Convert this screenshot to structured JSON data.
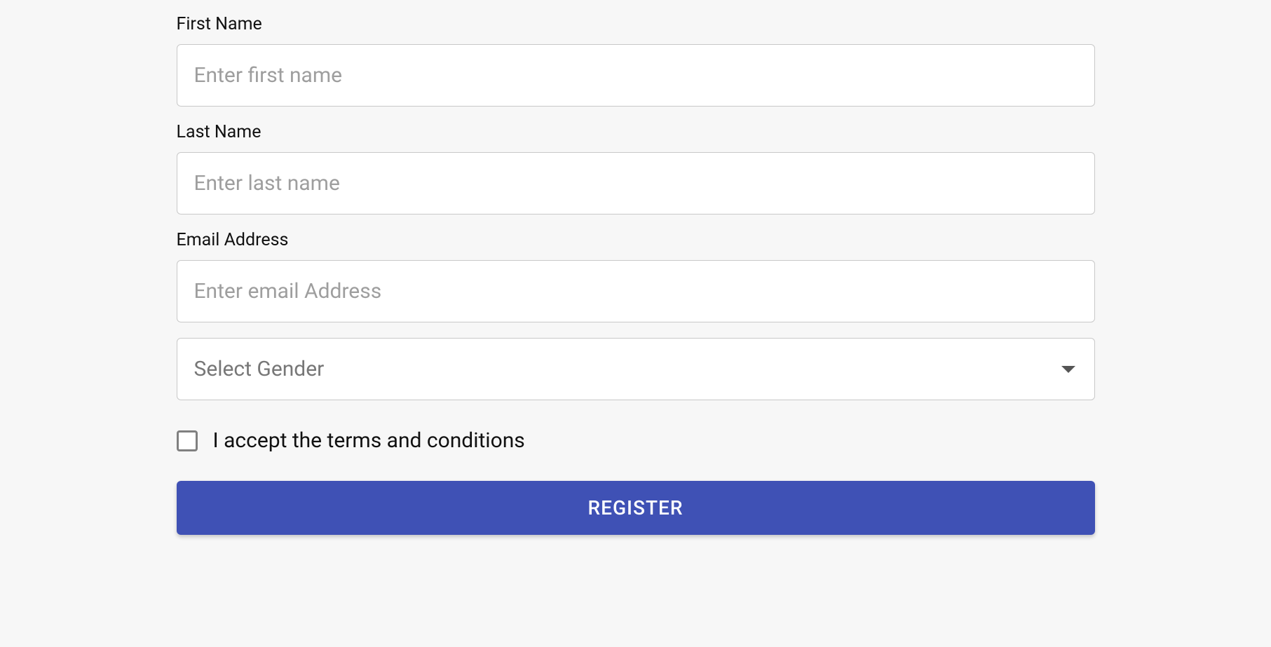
{
  "form": {
    "first_name": {
      "label": "First Name",
      "placeholder": "Enter first name",
      "value": ""
    },
    "last_name": {
      "label": "Last Name",
      "placeholder": "Enter last name",
      "value": ""
    },
    "email": {
      "label": "Email Address",
      "placeholder": "Enter email Address",
      "value": ""
    },
    "gender": {
      "placeholder": "Select Gender",
      "value": ""
    },
    "terms": {
      "label": "I accept the terms and conditions",
      "checked": false
    },
    "submit": {
      "label": "REGISTER"
    }
  }
}
